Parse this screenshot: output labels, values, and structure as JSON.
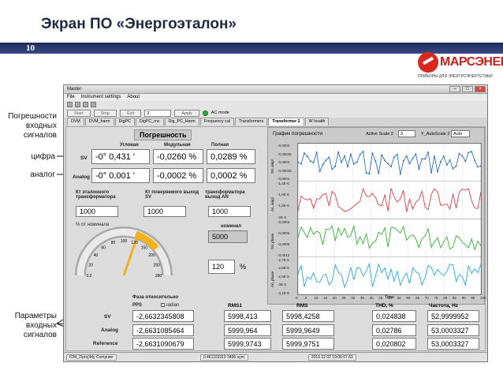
{
  "slide": {
    "title": "Экран ПО «Энергоэталон»",
    "number": "10",
    "brand": "МАРСЭНЕРГО",
    "brand_sub": "ПРИБОРЫ ДЛЯ ЭЛЕКТРОЭНЕРГЕТИКИ",
    "brand_color": "#c8201a",
    "band_color": "#1f2a5a"
  },
  "annotations": {
    "error_signals": "Погрешности входных сигналов",
    "digital": "цифра",
    "analog": "аналог",
    "input_params": "Параметры входных сигналов"
  },
  "window": {
    "title": "Master",
    "menu": [
      "File",
      "Instrument settings",
      "About"
    ],
    "toolbar": {
      "start": "Start",
      "stop": "Stop",
      "exit": "Exit",
      "field_value": "3",
      "apply": "Apply",
      "ac_mode": "AC mode"
    },
    "tabs": [
      "DVM",
      "DVM_harm",
      "DigPC",
      "DigPC_rnc",
      "Dig_PC_Harm",
      "Frequency cal",
      "Transformers",
      "Transformer 2",
      "W health"
    ],
    "active_tab": "Transformer 2",
    "status": [
      "ICM_2\\proj\\My Computer",
      "0.461103319 3496 sync",
      "2016.12.02 19:06:07.63"
    ]
  },
  "error_block": {
    "title": "Погрешность",
    "col_headers": [
      "Угловая",
      "Модульная",
      "Полная"
    ],
    "rows": [
      {
        "label": "SV",
        "angle": "-0° 0,431 '",
        "module": "-0,0260 %",
        "full": "0,0289 %"
      },
      {
        "label": "Analog",
        "angle": "-0° 0,001 '",
        "module": "-0,0002 %",
        "full": "0,0002 %"
      }
    ]
  },
  "coef": {
    "labels": [
      "Кт эталонного трансформатора",
      "Кт поверяемого выход SV",
      "трансформатора выход AN"
    ],
    "values": [
      "1000",
      "1000",
      "1000"
    ],
    "nominal_label": "номинал",
    "nominal_value": "5000",
    "percent_label": "% от номинала",
    "percent_value": "120",
    "percent_unit": "%",
    "gauge_value": 120,
    "gauge_ticks": [
      "0,2",
      "20",
      "40",
      "60",
      "80",
      "100",
      "120",
      "150",
      "200",
      "250",
      "280"
    ]
  },
  "chart": {
    "title": "График погрешности",
    "active_scale_label": "Active Scale 2",
    "active_scale_value": "3",
    "autoscale_label": "Y_AutoScale 2",
    "autoscale_value": "Auto",
    "x_label": "Time",
    "x_ticks": [
      "0",
      "5",
      "10",
      "15",
      "20",
      "25",
      "30",
      "35",
      "40",
      "45",
      "50",
      "55",
      "60",
      "65",
      "70",
      "75",
      "80",
      "85",
      "90",
      "95",
      "100"
    ],
    "panels": [
      {
        "ylabel": "SV, ampl",
        "ticks": [
          "-0,0002",
          "-0,00025",
          "-0,0003",
          "-0,00035",
          "-0,0004"
        ],
        "color": "#2a6fc4"
      },
      {
        "ylabel": "An, ampl",
        "ticks": [
          "-1,4E-6",
          "-1,6E-6",
          "-1,8E-6",
          "-2E-6"
        ],
        "color": "#e0393e"
      },
      {
        "ylabel": "SV, phase",
        "ticks": [
          "-0,0003",
          "-0,0006",
          "-0,0009",
          "-0,0012"
        ],
        "color": "#2fb12f"
      },
      {
        "ylabel": "An, phase",
        "ticks": [
          "-2,7E-5",
          "-2,8E-5",
          "-2,9E-5",
          "-3E-5",
          "-3,1E-5"
        ],
        "color": "#21a8d8"
      }
    ]
  },
  "phase_table": {
    "title": "Фаза относительно",
    "pps_label": "PPS",
    "radian_label": "radian",
    "headers": [
      "RMS1",
      "RMS",
      "THD, %",
      "Частота, Hz"
    ],
    "rows": [
      {
        "label": "SV",
        "phase": "-2,6632345808",
        "rms1": "5998,413",
        "rms": "5998,4258",
        "thd": "0,024838",
        "freq": "52,9999952"
      },
      {
        "label": "Analog",
        "phase": "-2,6631085464",
        "rms1": "5999,964",
        "rms": "5999,9649",
        "thd": "0,02786",
        "freq": "53,0003327"
      },
      {
        "label": "Reference",
        "phase": "-2,6631090679",
        "rms1": "5999,9743",
        "rms": "5999,9751",
        "thd": "0,020802",
        "freq": "53,0003327"
      }
    ]
  }
}
